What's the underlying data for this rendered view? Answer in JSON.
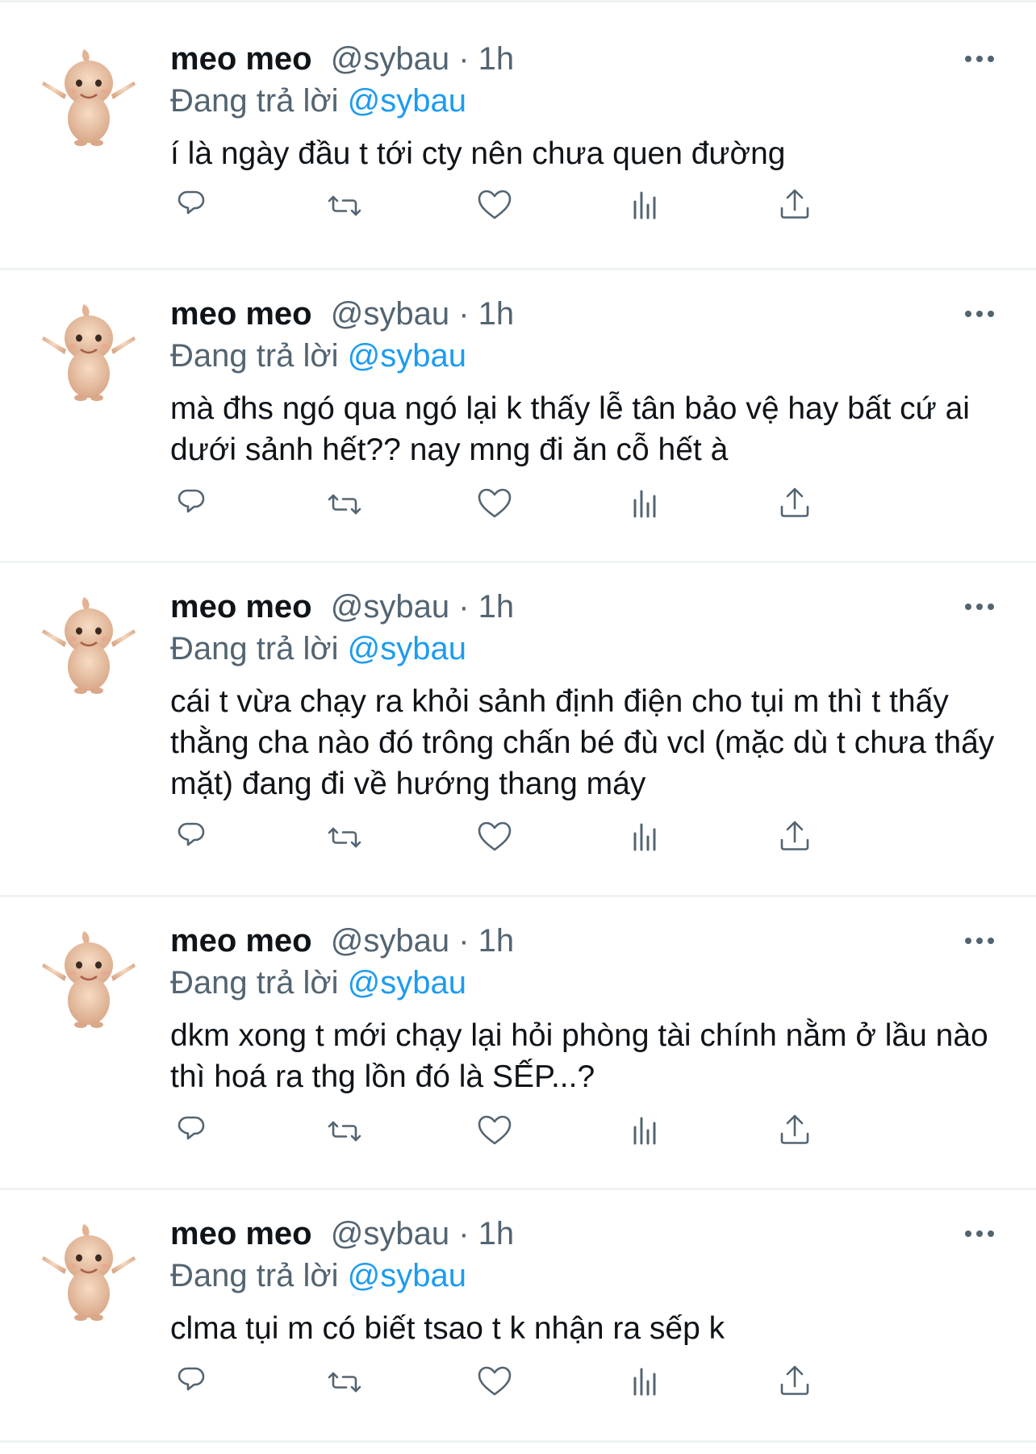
{
  "tweets": [
    {
      "display_name": "meo meo",
      "handle": "@sybau",
      "separator": "·",
      "time": "1h",
      "replying_prefix": "Đang trả lời",
      "replying_to": "@sybau",
      "text": "í là ngày đầu t tới cty nên chưa quen đường"
    },
    {
      "display_name": "meo meo",
      "handle": "@sybau",
      "separator": "·",
      "time": "1h",
      "replying_prefix": "Đang trả lời",
      "replying_to": "@sybau",
      "text": "mà đhs ngó qua ngó lại k thấy lễ tân bảo vệ hay bất cứ ai dưới sảnh hết?? nay mng đi ăn cỗ hết à"
    },
    {
      "display_name": "meo meo",
      "handle": "@sybau",
      "separator": "·",
      "time": "1h",
      "replying_prefix": "Đang trả lời",
      "replying_to": "@sybau",
      "text": "cái t vừa chạy ra khỏi sảnh định điện cho tụi m thì t thấy thằng cha nào đó trông chấn bé đù vcl (mặc dù t chưa thấy mặt) đang đi về hướng thang máy"
    },
    {
      "display_name": "meo meo",
      "handle": "@sybau",
      "separator": "·",
      "time": "1h",
      "replying_prefix": "Đang trả lời",
      "replying_to": "@sybau",
      "text": "dkm xong t mới chạy lại hỏi phòng tài chính nằm ở lầu nào thì hoá ra thg lồn đó là SẾP...?"
    },
    {
      "display_name": "meo meo",
      "handle": "@sybau",
      "separator": "·",
      "time": "1h",
      "replying_prefix": "Đang trả lời",
      "replying_to": "@sybau",
      "text": "clma tụi m có biết tsao t k nhận ra sếp k"
    }
  ],
  "icons": {
    "more": "more-dots-icon",
    "reply": "reply-icon",
    "retweet": "retweet-icon",
    "like": "heart-icon",
    "views": "analytics-icon",
    "share": "share-icon",
    "avatar": "kewpie-doll-avatar"
  },
  "colors": {
    "text_primary": "#0f1419",
    "text_secondary": "#536471",
    "mention": "#1d9bf0",
    "divider": "#eff3f4"
  }
}
